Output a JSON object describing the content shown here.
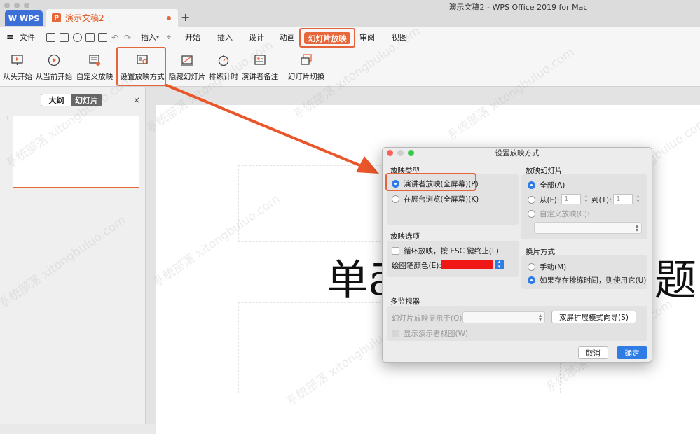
{
  "window": {
    "title": "演示文稿2 - WPS Office 2019 for Mac"
  },
  "tabs": {
    "wps_label": "WPS",
    "doc_label": "演示文稿2",
    "doc_icon": "P",
    "add_tab": "+"
  },
  "menubar": {
    "file": "文件",
    "items": [
      "插入",
      "开始",
      "插入",
      "设计",
      "动画",
      "幻灯片放映",
      "审阅",
      "视图"
    ],
    "active": "幻灯片放映"
  },
  "ribbon": {
    "buttons": [
      "从头开始",
      "从当前开始",
      "自定义放映",
      "设置放映方式",
      "隐藏幻灯片",
      "排练计时",
      "演讲者备注",
      "幻灯片切换"
    ]
  },
  "panel": {
    "outline_tab": "大纲",
    "slides_tab": "幻灯片",
    "close": "×",
    "slide_number": "1"
  },
  "slide": {
    "title_visible": "单ā",
    "title_tail": "题"
  },
  "dialog": {
    "title": "设置放映方式",
    "show_type": {
      "heading": "放映类型",
      "presenter": "演讲者放映(全屏幕)(P)",
      "kiosk": "在展台浏览(全屏幕)(K)"
    },
    "show_slides": {
      "heading": "放映幻灯片",
      "all": "全部(A)",
      "from": "从(F):",
      "from_value": "1",
      "to": "到(T):",
      "to_value": "1",
      "custom": "自定义放映(C):"
    },
    "options": {
      "heading": "放映选项",
      "loop": "循环放映，按 ESC 键终止(L)",
      "pen_color": "绘图笔颜色(E):",
      "pen_color_value": "#f01717"
    },
    "advance": {
      "heading": "换片方式",
      "manual": "手动(M)",
      "timings": "如果存在排练时间，则使用它(U)"
    },
    "monitors": {
      "heading": "多监视器",
      "show_on": "幻灯片放映显示于(O):",
      "wizard": "双屏扩展模式向导(S)",
      "presenter_view": "显示演示者视图(W)"
    },
    "buttons": {
      "cancel": "取消",
      "ok": "确定"
    }
  },
  "colors": {
    "accent": "#e8673a",
    "wps_blue": "#3d6fd8",
    "primary": "#2f7ce4"
  }
}
